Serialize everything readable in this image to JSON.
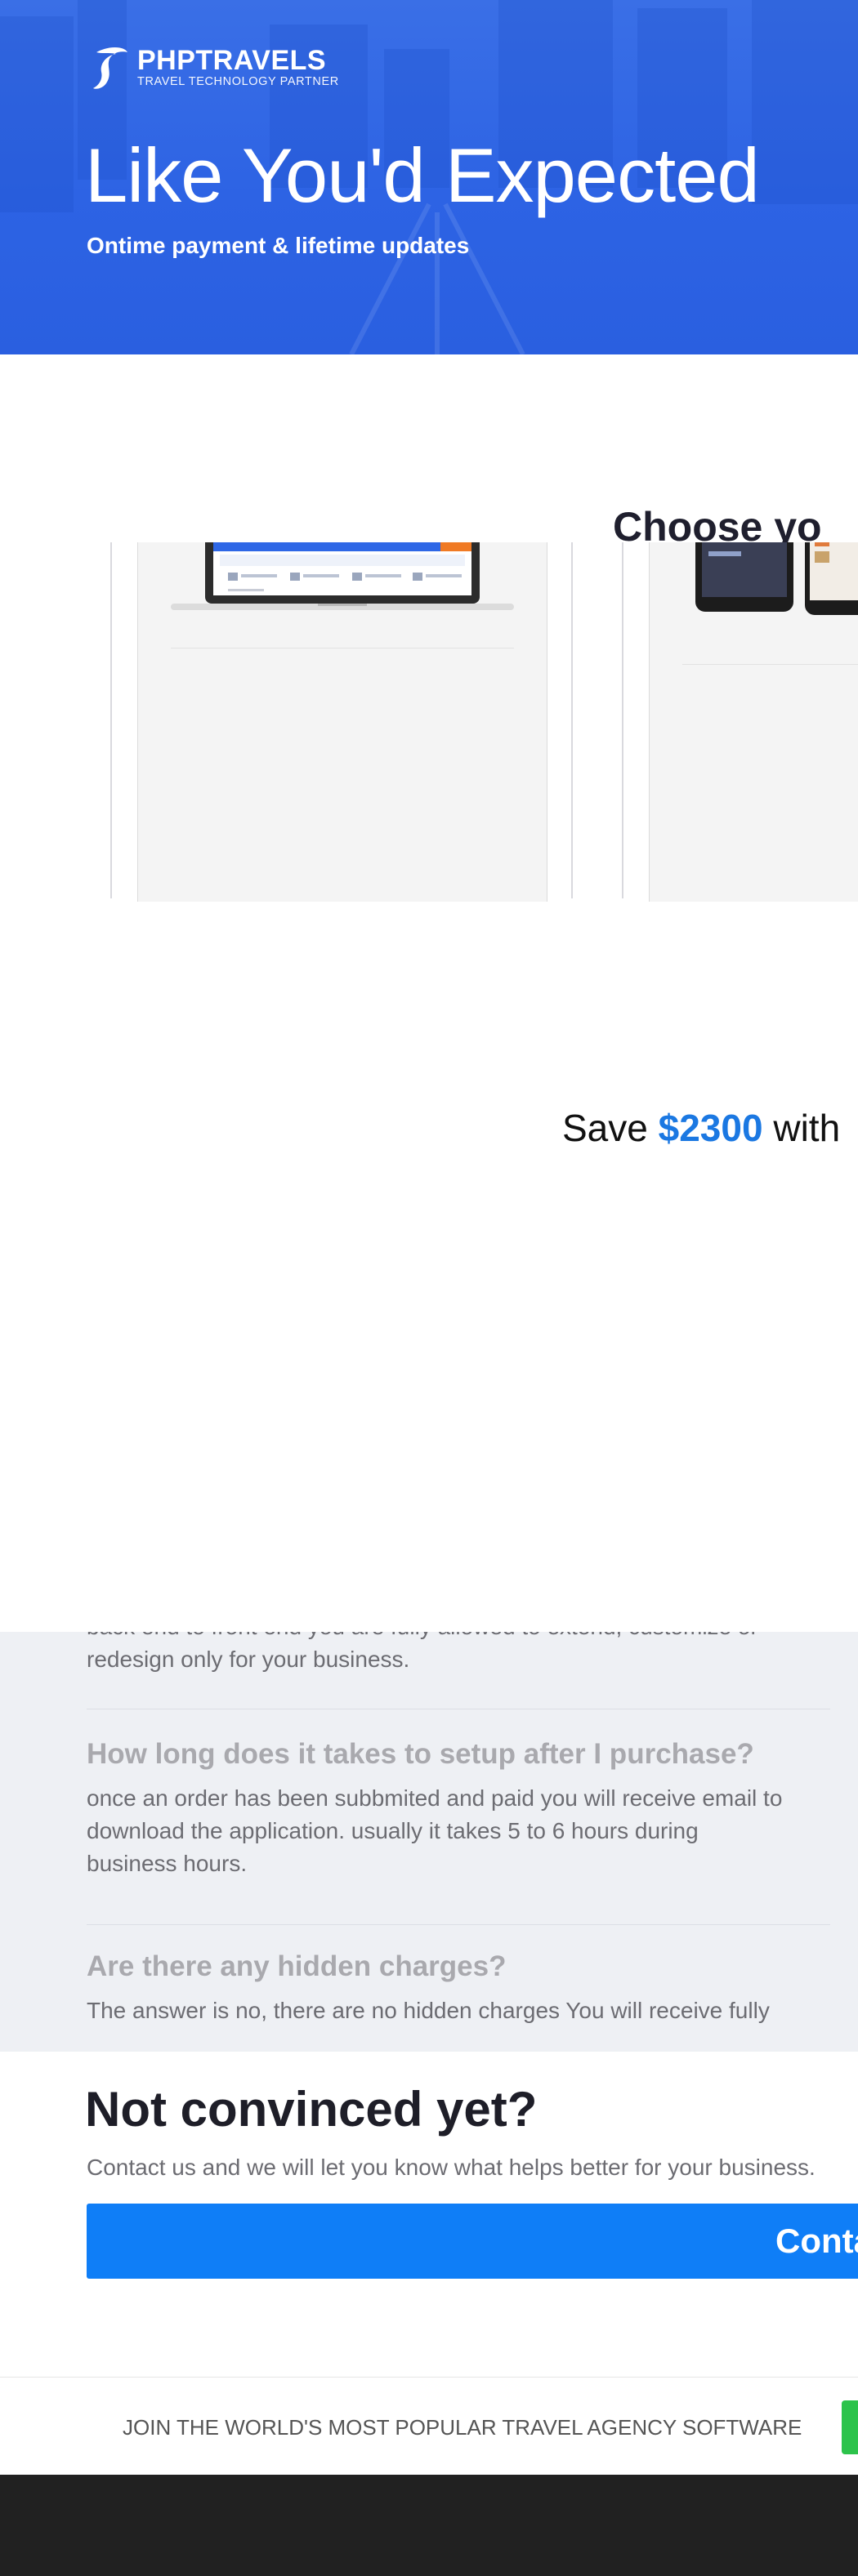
{
  "hero": {
    "brand_name": "PHPTRAVELS",
    "brand_tagline": "TRAVEL TECHNOLOGY PARTNER",
    "title": "Like You'd Expected",
    "subtitle": "Ontime payment & lifetime updates",
    "background_color": "#2d63e4",
    "logo_icon": "phptravels-logo-icon"
  },
  "products": {
    "section_title": "Choose yo",
    "save_prefix": "Save ",
    "save_amount": "$2300",
    "save_suffix": " with",
    "accent_color": "#1b78e2"
  },
  "faq": {
    "items": [
      {
        "question": "",
        "answer_line1": "back end to front end you are fully allowed to extend, customize or",
        "answer_line2": "redesign only for your business."
      },
      {
        "question": "How long does it takes to setup after I purchase?",
        "answer_line1": "once an order has been subbmited and paid you will receive email to",
        "answer_line2": "download the application. usually it takes 5 to 6 hours during",
        "answer_line3": "business hours."
      },
      {
        "question": "Are there any hidden charges?",
        "answer_line1": "The answer is no, there are no hidden charges You will receive fully"
      }
    ]
  },
  "contact": {
    "title": "Not convinced yet?",
    "subtitle": "Contact us and we will let you know what helps better for your business.",
    "button_label": "Conta",
    "button_color": "#0f7ef7"
  },
  "join": {
    "text": "JOIN THE WORLD'S MOST POPULAR TRAVEL AGENCY SOFTWARE",
    "button_color": "#2cc34b"
  },
  "footer": {
    "background_color": "#212121"
  }
}
